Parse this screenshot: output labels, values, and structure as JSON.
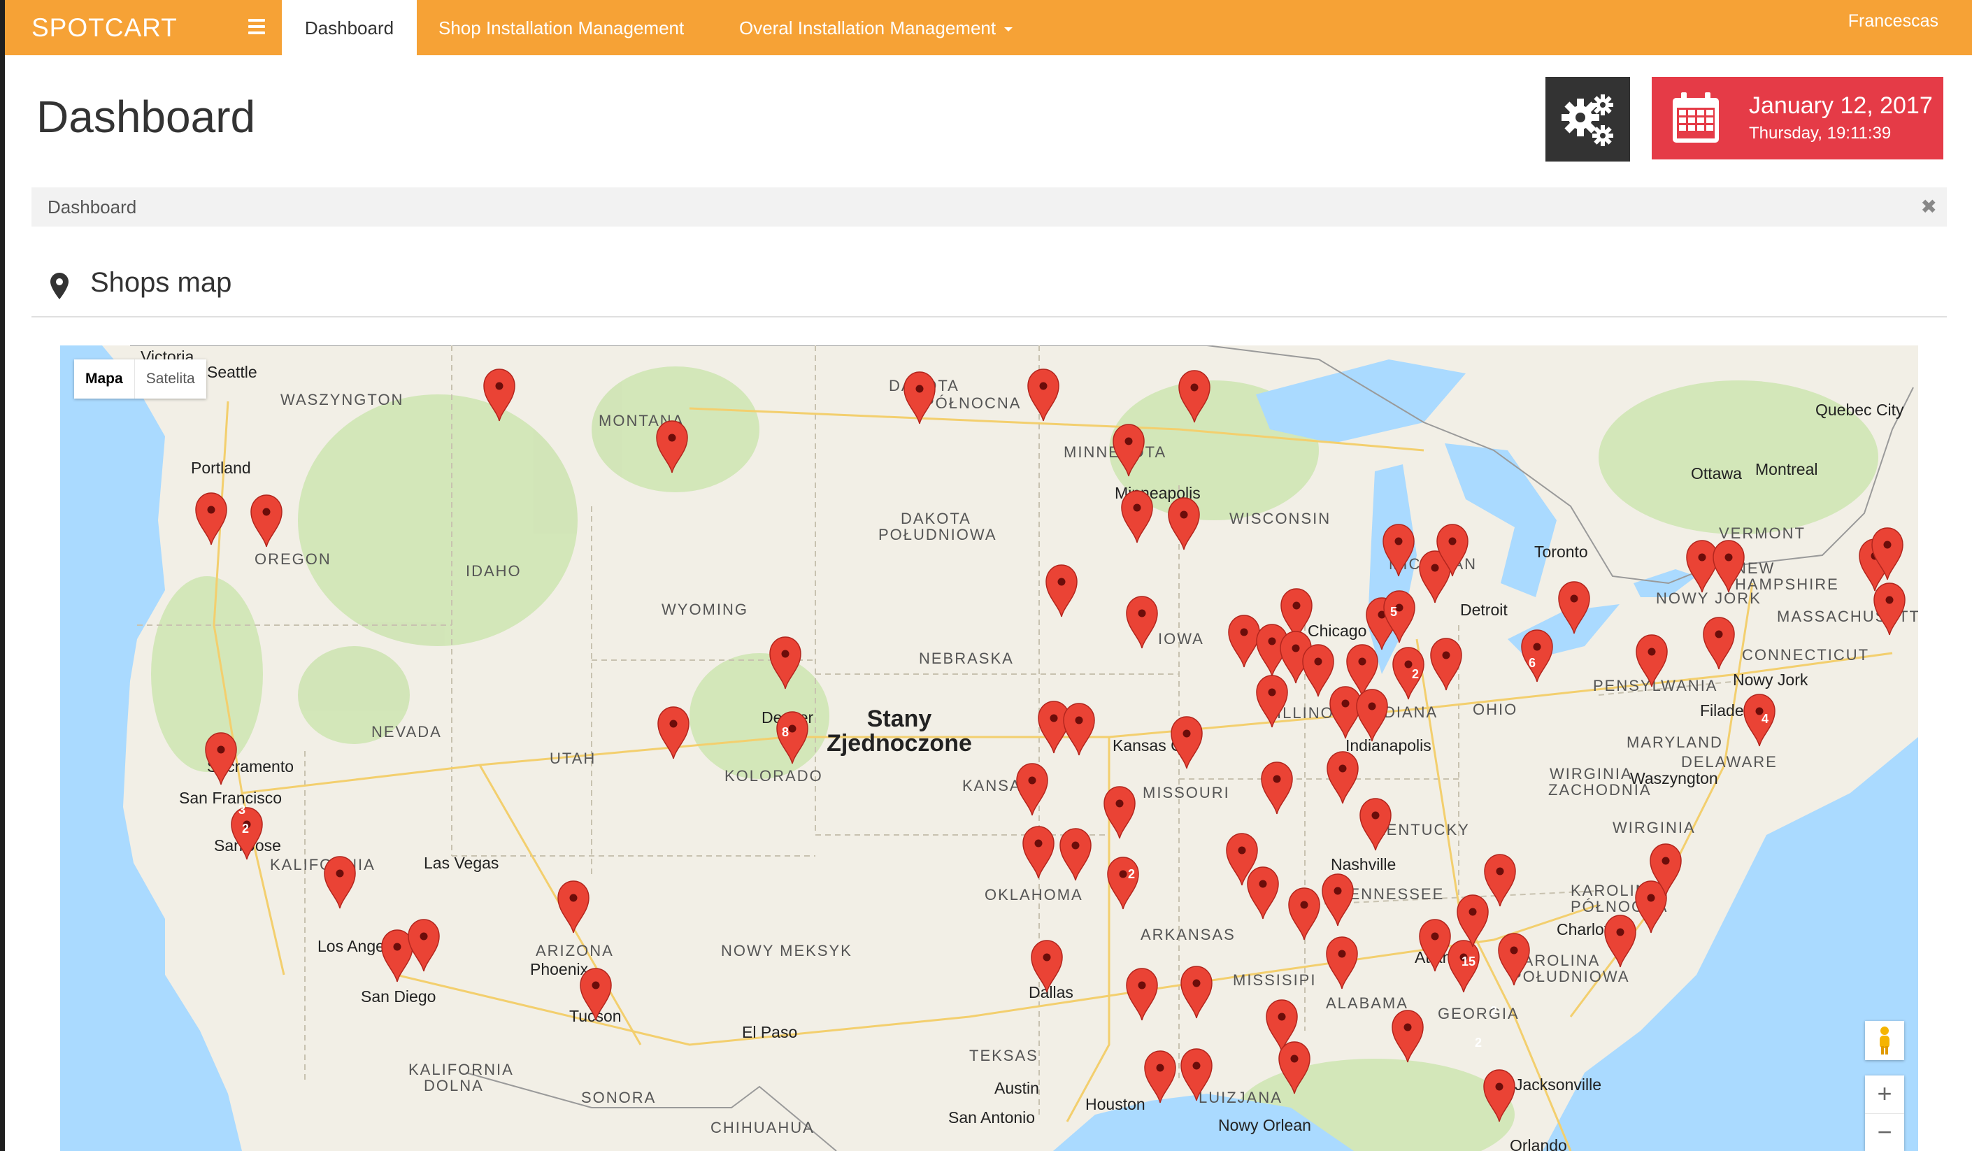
{
  "navbar": {
    "brand": "SPOTCART",
    "items": [
      {
        "label": "Dashboard"
      },
      {
        "label": "Shop Installation Management"
      },
      {
        "label": "Overal Installation Management"
      }
    ],
    "user": "Francescas"
  },
  "header": {
    "title": "Dashboard",
    "date": "January 12, 2017",
    "time": "Thursday, 19:11:39"
  },
  "breadcrumb": {
    "label": "Dashboard",
    "close": "✖"
  },
  "section": {
    "title": "Shops map"
  },
  "map": {
    "type_controls": {
      "map": "Mapa",
      "satellite": "Satelita"
    },
    "zoom_in": "+",
    "zoom_out": "−",
    "country_line1": "Stany",
    "country_line2": "Zjednoczone",
    "states": [
      "WASZYNGTON",
      "OREGON",
      "IDAHO",
      "MONTANA",
      "WYOMING",
      "NEVADA",
      "UTAH",
      "KALIFORNIA",
      "ARIZONA",
      "NOWY MEKSYK",
      "KOLORADO",
      "DAKOTA",
      "PÓŁNOCNA",
      "DAKOTA",
      "POŁUDNIOWA",
      "NEBRASKA",
      "KANSAS",
      "OKLAHOMA",
      "TEKSAS",
      "MINNESOTA",
      "IOWA",
      "MISSOURI",
      "ARKANSAS",
      "LUIZJANA",
      "WISCONSIN",
      "ILLINOIS",
      "MICHIGAN",
      "INDIANA",
      "OHIO",
      "KENTUCKY",
      "TENNESSEE",
      "MISSISIPI",
      "ALABAMA",
      "GEORGIA",
      "PENSYLWANIA",
      "NOWY JORK",
      "WIRGINIA",
      "ZACHODNIA",
      "WIRGINIA",
      "MARYLAND",
      "DELAWARE",
      "KAROLINA",
      "PÓŁNOCNA",
      "KAROLINA",
      "POŁUDNIOWA",
      "VERMONT",
      "NEW",
      "HAMPSHIRE",
      "MASSACHUSETTS",
      "CONNECTICUT",
      "KALIFORNIA",
      "DOLNA",
      "SONORA",
      "CHIHUAHUA"
    ],
    "cities": [
      "Victoria",
      "Seattle",
      "Portland",
      "Sacramento",
      "San Francisco",
      "San Jose",
      "Los Angeles",
      "San Diego",
      "Las Vegas",
      "Phoenix",
      "Tucson",
      "El Paso",
      "Denver",
      "Minneapolis",
      "Chicago",
      "Detroit",
      "Toronto",
      "Ottawa",
      "Montreal",
      "Quebec City",
      "Kansas City",
      "Indianapolis",
      "Nashville",
      "Charlotte",
      "Atlanta",
      "Dallas",
      "Austin",
      "San Antonio",
      "Houston",
      "Nowy Orlean",
      "Jacksonville",
      "Orlando",
      "Nowy Jork",
      "Filadelfia",
      "Waszyngton"
    ],
    "cluster_counts": [
      "3",
      "2",
      "8",
      "5",
      "2",
      "2",
      "6",
      "15",
      "2",
      "4",
      "2"
    ]
  }
}
